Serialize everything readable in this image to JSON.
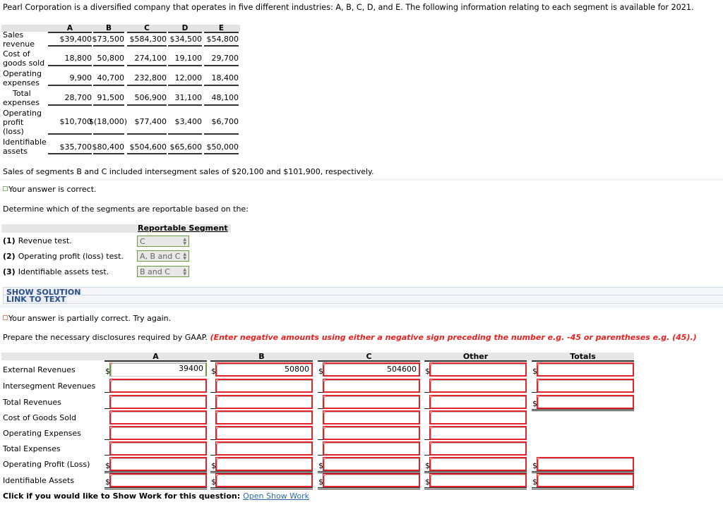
{
  "intro": "Pearl Corporation is a diversified company that operates in five different industries: A, B, C, D, and E. The following information relating to each segment is available for 2021.",
  "segment_table": {
    "columns": [
      "A",
      "B",
      "C",
      "D",
      "E"
    ],
    "rows": [
      {
        "label": "Sales revenue",
        "values": [
          "$39,400",
          "$73,500",
          "$584,300",
          "$34,500",
          "$54,800"
        ]
      },
      {
        "label": "Cost of goods sold",
        "values": [
          "18,800",
          "50,800",
          "274,100",
          "19,100",
          "29,700"
        ]
      },
      {
        "label": "Operating expenses",
        "values": [
          "9,900",
          "40,700",
          "232,800",
          "12,000",
          "18,400"
        ]
      },
      {
        "label": "Total expenses",
        "values": [
          "28,700",
          "91,500",
          "506,900",
          "31,100",
          "48,100"
        ]
      },
      {
        "label": "Operating profit (loss)",
        "values": [
          "$10,700",
          "$(18,000)",
          "$77,400",
          "$3,400",
          "$6,700"
        ]
      },
      {
        "label": "Identifiable assets",
        "values": [
          "$35,700",
          "$80,400",
          "$504,600",
          "$65,600",
          "$50,000"
        ]
      }
    ]
  },
  "intersegment_note": "Sales of segments B and C included intersegment sales of $20,100 and $101,900, respectively.",
  "feedback_correct": "Your answer is correct.",
  "determine_prompt": "Determine which of the segments are reportable based on the:",
  "reportable": {
    "header": "Reportable Segment",
    "tests": [
      {
        "num": "(1)",
        "label": "Revenue test.",
        "selected": "C"
      },
      {
        "num": "(2)",
        "label": "Operating profit (loss) test.",
        "selected": "A, B and C"
      },
      {
        "num": "(3)",
        "label": "Identifiable assets test.",
        "selected": "B and C"
      }
    ]
  },
  "links": {
    "show_solution": "SHOW SOLUTION",
    "link_to_text": "LINK TO TEXT"
  },
  "feedback_partial": "Your answer is partially correct.  Try again.",
  "disclosure": {
    "prompt": "Prepare the necessary disclosures required by GAAP.",
    "instruction": "(Enter negative amounts using either a negative sign preceding the number e.g. -45 or parentheses e.g. (45).)",
    "columns": [
      "A",
      "B",
      "C",
      "Other",
      "Totals"
    ],
    "rows": [
      {
        "label": "External Revenues",
        "values": [
          "39400",
          "50800",
          "504600",
          "",
          ""
        ]
      },
      {
        "label": "Intersegment Revenues",
        "values": [
          "",
          "",
          "",
          "",
          ""
        ]
      },
      {
        "label": "Total Revenues",
        "values": [
          "",
          "",
          "",
          "",
          ""
        ]
      },
      {
        "label": "Cost of Goods Sold",
        "values": [
          "",
          "",
          "",
          ""
        ]
      },
      {
        "label": "Operating Expenses",
        "values": [
          "",
          "",
          "",
          ""
        ]
      },
      {
        "label": "Total Expenses",
        "values": [
          "",
          "",
          "",
          ""
        ]
      },
      {
        "label": "Operating Profit (Loss)",
        "values": [
          "",
          "",
          "",
          "",
          ""
        ]
      },
      {
        "label": "Identifiable Assets",
        "values": [
          "",
          "",
          "",
          "",
          ""
        ]
      }
    ],
    "currency_symbol": "$"
  },
  "show_work": {
    "prompt": "Click if you would like to Show Work for this question:",
    "link": "Open Show Work"
  }
}
